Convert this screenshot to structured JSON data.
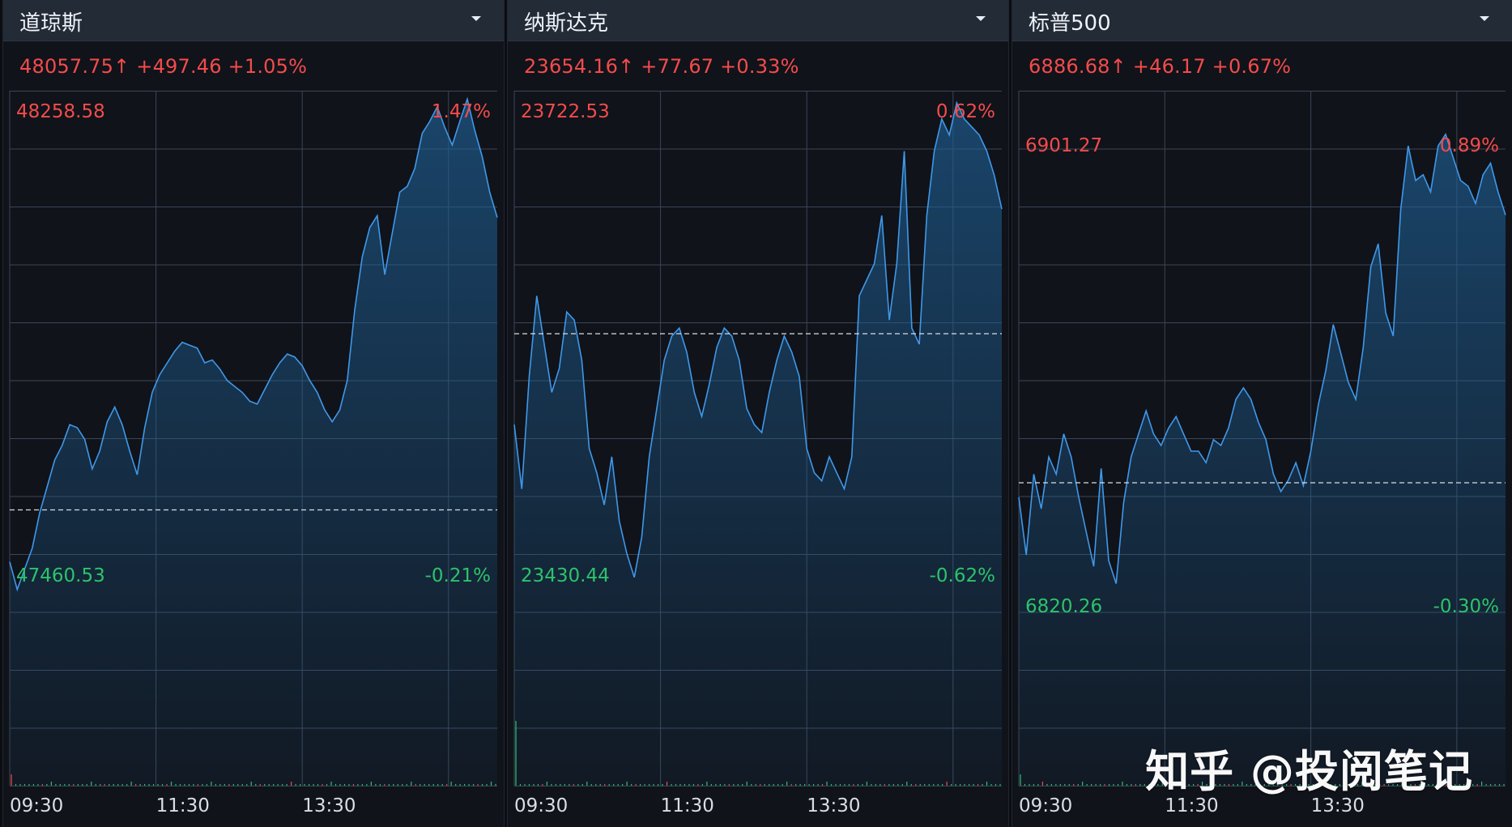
{
  "panels": [
    {
      "title": "道琼斯",
      "quote": "48057.75↑ +497.46 +1.05%",
      "high_value": "48258.58",
      "high_pct": "1.47%",
      "low_value": "47460.53",
      "low_pct": "-0.21%",
      "times": [
        "09:30",
        "11:30",
        "13:30"
      ],
      "intraday_values": [
        47472,
        47425,
        47460,
        47495,
        47555,
        47600,
        47645,
        47670,
        47705,
        47700,
        47680,
        47630,
        47660,
        47710,
        47735,
        47705,
        47660,
        47620,
        47700,
        47760,
        47790,
        47810,
        47830,
        47845,
        47840,
        47835,
        47810,
        47815,
        47800,
        47780,
        47770,
        47760,
        47745,
        47740,
        47765,
        47790,
        47810,
        47825,
        47820,
        47805,
        47780,
        47760,
        47730,
        47710,
        47730,
        47780,
        47900,
        47990,
        48040,
        48060,
        47960,
        48030,
        48100,
        48110,
        48140,
        48200,
        48220,
        48245,
        48210,
        48180,
        48220,
        48258,
        48205,
        48160,
        48100,
        48057
      ],
      "high": 48258.58,
      "low": 47460.53,
      "baseline": 47560.29
    },
    {
      "title": "纳斯达克",
      "quote": "23654.16↑ +77.67 +0.33%",
      "high_value": "23722.53",
      "high_pct": "0.62%",
      "low_value": "23430.44",
      "low_pct": "-0.62%",
      "times": [
        "09:30",
        "11:30",
        "13:30"
      ],
      "intraday_values": [
        23520,
        23480,
        23550,
        23600,
        23570,
        23540,
        23555,
        23590,
        23585,
        23560,
        23505,
        23490,
        23470,
        23500,
        23460,
        23440,
        23425,
        23450,
        23500,
        23530,
        23560,
        23575,
        23580,
        23565,
        23540,
        23525,
        23545,
        23568,
        23580,
        23575,
        23560,
        23530,
        23520,
        23515,
        23540,
        23560,
        23575,
        23565,
        23550,
        23505,
        23490,
        23485,
        23500,
        23490,
        23480,
        23500,
        23600,
        23610,
        23620,
        23650,
        23585,
        23620,
        23690,
        23580,
        23570,
        23650,
        23690,
        23710,
        23700,
        23720,
        23710,
        23705,
        23700,
        23690,
        23675,
        23654
      ],
      "high": 23722.53,
      "low": 23430.44,
      "baseline": 23576.49
    },
    {
      "title": "标普500",
      "quote": "6886.68↑ +46.17 +0.67%",
      "high_value": "6901.27",
      "high_pct": "0.89%",
      "low_value": "6820.26",
      "low_pct": "-0.30%",
      "times": [
        "09:30",
        "11:30",
        "13:30"
      ],
      "intraday_values": [
        6838,
        6828,
        6842,
        6836,
        6845,
        6842,
        6849,
        6845,
        6838,
        6832,
        6826,
        6843,
        6827,
        6823,
        6837,
        6845,
        6849,
        6853,
        6849,
        6847,
        6850,
        6852,
        6849,
        6846,
        6846,
        6844,
        6848,
        6847,
        6850,
        6855,
        6857,
        6855,
        6851,
        6848,
        6842,
        6839,
        6841,
        6844,
        6840,
        6846,
        6854,
        6860,
        6868,
        6863,
        6858,
        6855,
        6864,
        6878,
        6882,
        6870,
        6866,
        6888,
        6899,
        6893,
        6894,
        6891,
        6899,
        6901,
        6897,
        6893,
        6892,
        6889,
        6894,
        6896,
        6891,
        6887
      ],
      "high": 6901.27,
      "low": 6820.26,
      "baseline": 6840.51
    }
  ],
  "watermark": "知乎 @投阅笔记",
  "colors": {
    "background": "#10131a",
    "header": "#232b37",
    "grid": "#3b4656",
    "line": "#3f98ea",
    "fill": "#1f6095",
    "red": "#f44b4b",
    "green": "#2cc36b",
    "baseline": "#d8dde5"
  },
  "icons": {
    "dropdown": "chevron-down-icon"
  }
}
